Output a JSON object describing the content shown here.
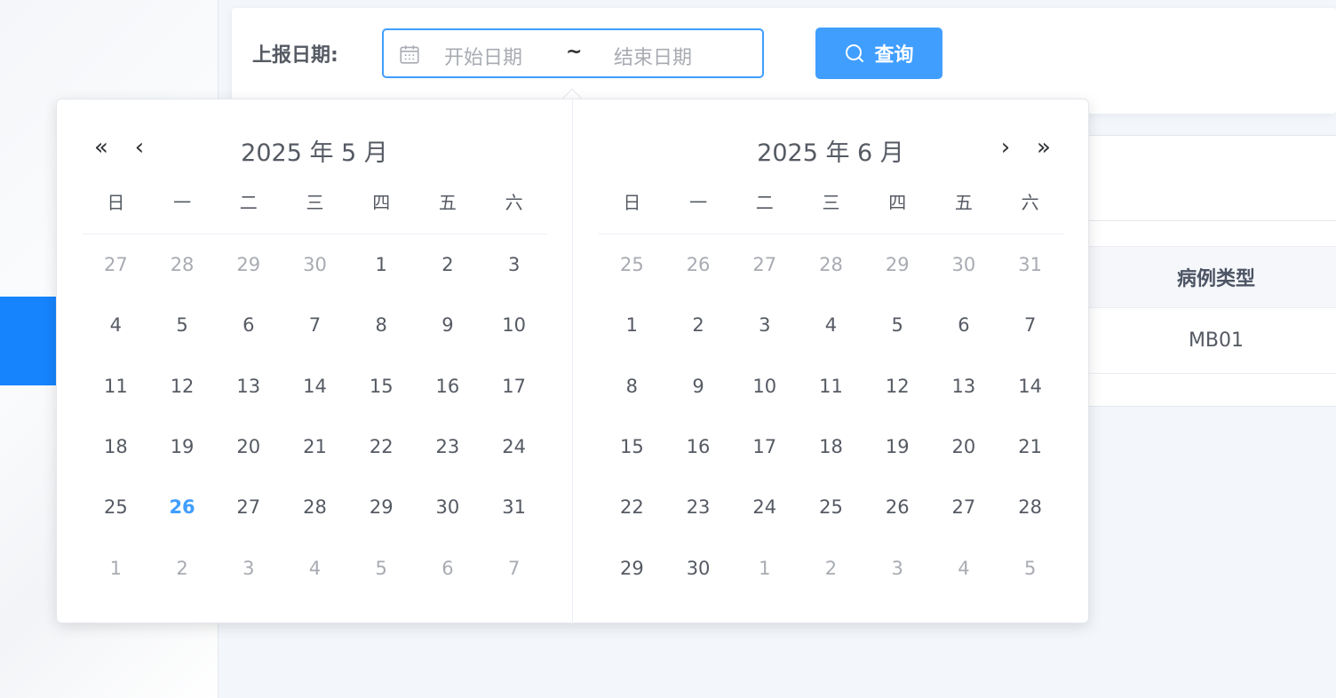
{
  "search": {
    "label": "上报日期:",
    "start_placeholder": "开始日期",
    "separator": "~",
    "end_placeholder": "结束日期",
    "button_label": "查询"
  },
  "table": {
    "column_header": "病例类型",
    "rows": [
      "MB01"
    ]
  },
  "picker": {
    "weekdays": [
      "日",
      "一",
      "二",
      "三",
      "四",
      "五",
      "六"
    ],
    "left": {
      "title": "2025 年 5 月",
      "weeks": [
        [
          [
            "27",
            "other"
          ],
          [
            "28",
            "other"
          ],
          [
            "29",
            "other"
          ],
          [
            "30",
            "other"
          ],
          [
            "1",
            ""
          ],
          [
            "2",
            ""
          ],
          [
            "3",
            ""
          ]
        ],
        [
          [
            "4",
            ""
          ],
          [
            "5",
            ""
          ],
          [
            "6",
            ""
          ],
          [
            "7",
            ""
          ],
          [
            "8",
            ""
          ],
          [
            "9",
            ""
          ],
          [
            "10",
            ""
          ]
        ],
        [
          [
            "11",
            ""
          ],
          [
            "12",
            ""
          ],
          [
            "13",
            ""
          ],
          [
            "14",
            ""
          ],
          [
            "15",
            ""
          ],
          [
            "16",
            ""
          ],
          [
            "17",
            ""
          ]
        ],
        [
          [
            "18",
            ""
          ],
          [
            "19",
            ""
          ],
          [
            "20",
            ""
          ],
          [
            "21",
            ""
          ],
          [
            "22",
            ""
          ],
          [
            "23",
            ""
          ],
          [
            "24",
            ""
          ]
        ],
        [
          [
            "25",
            ""
          ],
          [
            "26",
            "today"
          ],
          [
            "27",
            ""
          ],
          [
            "28",
            ""
          ],
          [
            "29",
            ""
          ],
          [
            "30",
            ""
          ],
          [
            "31",
            ""
          ]
        ],
        [
          [
            "1",
            "other"
          ],
          [
            "2",
            "other"
          ],
          [
            "3",
            "other"
          ],
          [
            "4",
            "other"
          ],
          [
            "5",
            "other"
          ],
          [
            "6",
            "other"
          ],
          [
            "7",
            "other"
          ]
        ]
      ]
    },
    "right": {
      "title": "2025 年 6 月",
      "weeks": [
        [
          [
            "25",
            "other"
          ],
          [
            "26",
            "other"
          ],
          [
            "27",
            "other"
          ],
          [
            "28",
            "other"
          ],
          [
            "29",
            "other"
          ],
          [
            "30",
            "other"
          ],
          [
            "31",
            "other"
          ]
        ],
        [
          [
            "1",
            ""
          ],
          [
            "2",
            ""
          ],
          [
            "3",
            ""
          ],
          [
            "4",
            ""
          ],
          [
            "5",
            ""
          ],
          [
            "6",
            ""
          ],
          [
            "7",
            ""
          ]
        ],
        [
          [
            "8",
            ""
          ],
          [
            "9",
            ""
          ],
          [
            "10",
            ""
          ],
          [
            "11",
            ""
          ],
          [
            "12",
            ""
          ],
          [
            "13",
            ""
          ],
          [
            "14",
            ""
          ]
        ],
        [
          [
            "15",
            ""
          ],
          [
            "16",
            ""
          ],
          [
            "17",
            ""
          ],
          [
            "18",
            ""
          ],
          [
            "19",
            ""
          ],
          [
            "20",
            ""
          ],
          [
            "21",
            ""
          ]
        ],
        [
          [
            "22",
            ""
          ],
          [
            "23",
            ""
          ],
          [
            "24",
            ""
          ],
          [
            "25",
            ""
          ],
          [
            "26",
            ""
          ],
          [
            "27",
            ""
          ],
          [
            "28",
            ""
          ]
        ],
        [
          [
            "29",
            ""
          ],
          [
            "30",
            ""
          ],
          [
            "1",
            "other"
          ],
          [
            "2",
            "other"
          ],
          [
            "3",
            "other"
          ],
          [
            "4",
            "other"
          ],
          [
            "5",
            "other"
          ]
        ]
      ]
    },
    "nav": {
      "prev_year": "«",
      "prev_month": "‹",
      "next_month": "›",
      "next_year": "»"
    }
  },
  "colors": {
    "accent": "#409eff",
    "sidebar_active": "#1684fc",
    "today": "#409eff"
  }
}
